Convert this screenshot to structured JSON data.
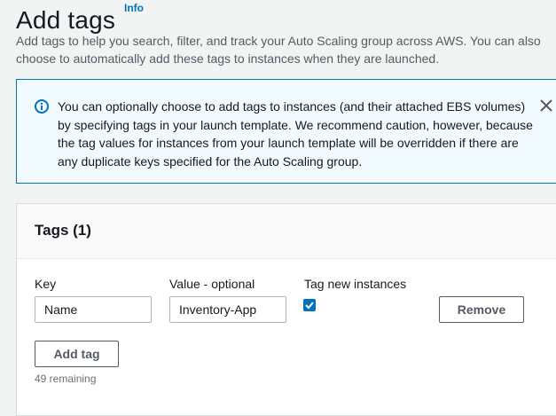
{
  "header": {
    "title": "Add tags",
    "info_label": "Info",
    "description": "Add tags to help you search, filter, and track your Auto Scaling group across AWS. You can also choose to automatically add these tags to instances when they are launched."
  },
  "alert": {
    "icon": "info-circle-icon",
    "text": "You can optionally choose to add tags to instances (and their attached EBS volumes) by specifying tags in your launch template. We recommend caution, however, because the tag values for instances from your launch template will be overridden if there are any duplicate keys specified for the Auto Scaling group.",
    "close_icon": "close-icon"
  },
  "tags_panel": {
    "title": "Tags (1)",
    "columns": {
      "key": "Key",
      "value": "Value - optional",
      "tag_new_instances": "Tag new instances"
    },
    "rows": [
      {
        "key": "Name",
        "value": "Inventory-App",
        "tag_new_instances": true,
        "remove_label": "Remove"
      }
    ],
    "add_tag_label": "Add tag",
    "remaining_text": "49 remaining"
  },
  "colors": {
    "accent": "#0073bb",
    "alert_background": "#f1faff",
    "page_background": "#f2f3f3"
  }
}
